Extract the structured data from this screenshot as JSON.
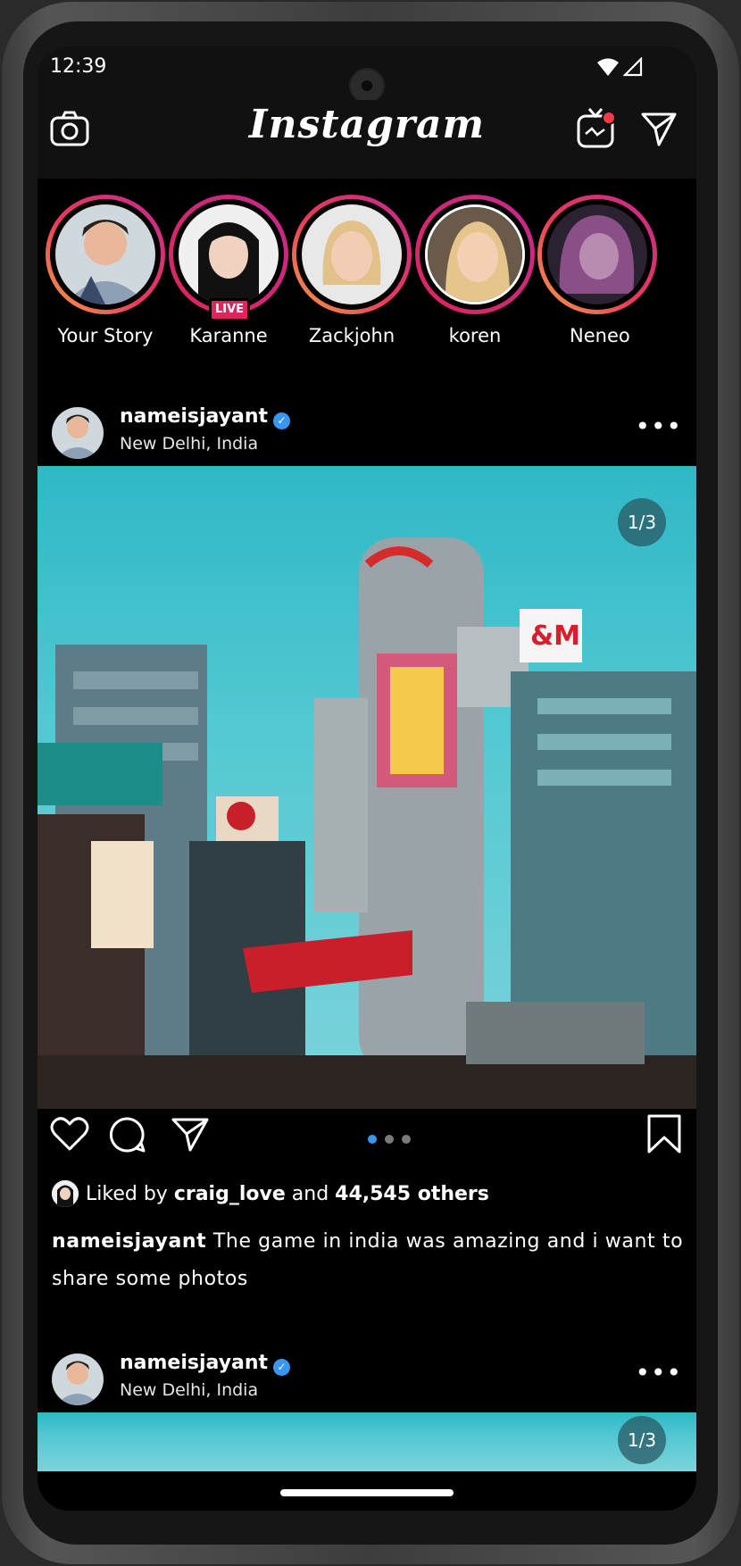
{
  "status_bar": {
    "time": "12:39"
  },
  "header": {
    "logo": "Instagram"
  },
  "stories": [
    {
      "name": "Your Story",
      "live": false
    },
    {
      "name": "Karanne",
      "live": true
    },
    {
      "name": "Zackjohn",
      "live": false
    },
    {
      "name": "koren",
      "live": false
    },
    {
      "name": "Neneo",
      "live": false
    }
  ],
  "live_label": "LIVE",
  "post1": {
    "username": "nameisjayant",
    "location": "New Delhi, India",
    "counter": "1/3",
    "liked_prefix": "Liked by",
    "liked_user": "craig_love",
    "liked_and": "and",
    "liked_count": "44,545 others",
    "caption_user": "nameisjayant",
    "caption_text": "The game in india was amazing and i want to share some photos",
    "page_dots": 3,
    "active_dot": 0
  },
  "post2": {
    "username": "nameisjayant",
    "location": "New Delhi, India",
    "counter": "1/3"
  },
  "colors": {
    "accent": "#3897f0",
    "live": "#e0245e",
    "ring_start": "#f6a14a",
    "ring_end": "#c22a8e"
  }
}
